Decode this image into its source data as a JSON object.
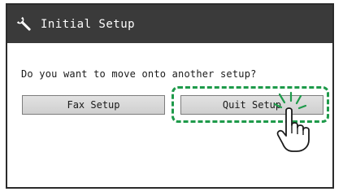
{
  "window": {
    "title": "Initial Setup",
    "title_icon": "wrench-icon"
  },
  "dialog": {
    "prompt": "Do you want to move onto another setup?",
    "buttons": [
      {
        "label": "Fax Setup"
      },
      {
        "label": "Quit Setup"
      }
    ]
  },
  "annotation": {
    "highlight_color": "#1e9a4a",
    "pointer_icon": "tapping-hand-icon"
  },
  "colors": {
    "titlebar_bg": "#3a3a3a",
    "titlebar_text": "#ffffff",
    "button_bg": "#d8d8d8"
  }
}
